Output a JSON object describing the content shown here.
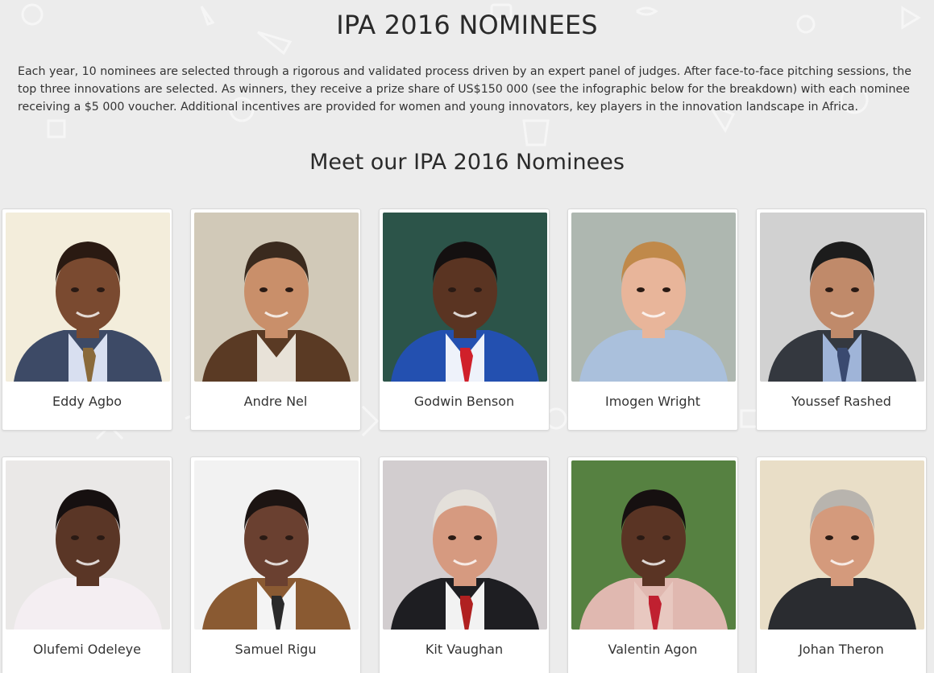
{
  "page": {
    "title": "IPA 2016 NOMINEES",
    "intro": "Each year, 10 nominees are selected through a rigorous and validated process driven by an expert panel of judges. After face-to-face pitching sessions, the top three innovations are selected. As winners, they receive a prize share of US$150 000 (see the infographic below for the breakdown) with each nominee receiving a $5 000 voucher. Additional incentives are provided for women and young innovators, key players in the innovation landscape in Africa.",
    "section_heading": "Meet our IPA 2016 Nominees"
  },
  "nominees": [
    {
      "name": "Eddy Agbo",
      "bg": "#f3ecd9",
      "skin": "#7a4a30",
      "hair": "#2a1a12",
      "shirt": "#d8dff0",
      "jacket": "#3d4a66",
      "tie": "#8a6a3a"
    },
    {
      "name": "Andre Nel",
      "bg": "#cfc6b4",
      "skin": "#c98f6a",
      "hair": "#3a2a1e",
      "shirt": "#e8e2d8",
      "jacket": "#5a3a24",
      "tie": ""
    },
    {
      "name": "Godwin Benson",
      "bg": "#1f4a3e",
      "skin": "#5a3422",
      "hair": "#141010",
      "shirt": "#eef2fa",
      "jacket": "#2350b0",
      "tie": "#d0202a"
    },
    {
      "name": "Imogen Wright",
      "bg": "#a9b3ac",
      "skin": "#e8b59a",
      "hair": "#c0894a",
      "shirt": "#aac0dc",
      "jacket": "#aac0dc",
      "tie": ""
    },
    {
      "name": "Youssef Rashed",
      "bg": "#cfcfcf",
      "skin": "#c08a6a",
      "hair": "#1c1c1c",
      "shirt": "#9fb4d8",
      "jacket": "#34383f",
      "tie": "#3a4a70"
    },
    {
      "name": "Olufemi Odeleye",
      "bg": "#e9e7e6",
      "skin": "#5a3626",
      "hair": "#161010",
      "shirt": "#f4eef2",
      "jacket": "#f4eef2",
      "tie": ""
    },
    {
      "name": "Samuel Rigu",
      "bg": "#f2f2f2",
      "skin": "#6a4030",
      "hair": "#1c1412",
      "shirt": "#f4f4f4",
      "jacket": "#8a5a32",
      "tie": "#2a2a2a"
    },
    {
      "name": "Kit Vaughan",
      "bg": "#d0cacd",
      "skin": "#d69a80",
      "hair": "#e4e0da",
      "shirt": "#f2f2f2",
      "jacket": "#1e1e22",
      "tie": "#b02020"
    },
    {
      "name": "Valentin Agon",
      "bg": "#4c7a36",
      "skin": "#5a3424",
      "hair": "#161010",
      "shirt": "#e8c8c0",
      "jacket": "#e0b8b0",
      "tie": "#c02030"
    },
    {
      "name": "Johan Theron",
      "bg": "#e8dcc4",
      "skin": "#d49a7c",
      "hair": "#b8b4ae",
      "shirt": "#2a2c30",
      "jacket": "#2a2c30",
      "tie": ""
    }
  ]
}
